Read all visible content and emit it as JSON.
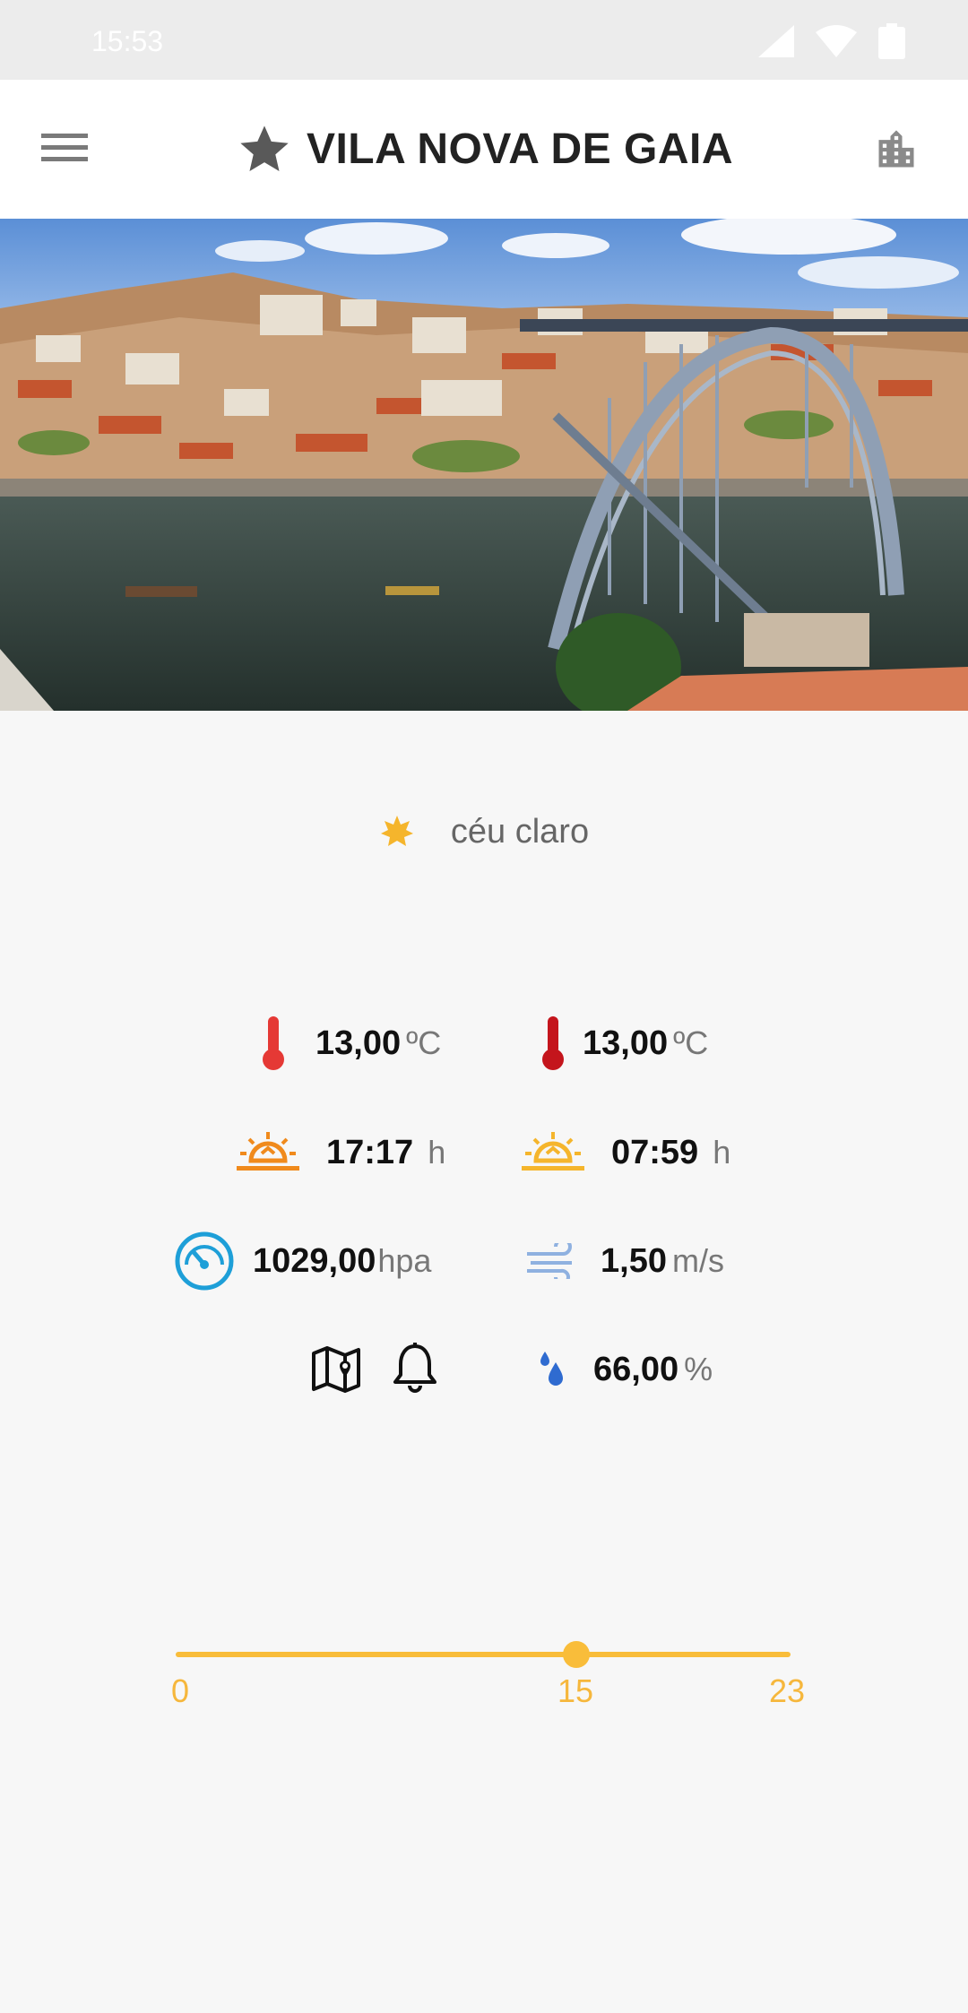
{
  "status_bar": {
    "time": "15:53"
  },
  "app_bar": {
    "title": "VILA NOVA DE GAIA"
  },
  "weather": {
    "condition": "céu claro",
    "temp": {
      "value": "13,00",
      "unit": "ºC"
    },
    "temp_max": {
      "value": "13,00",
      "unit": "ºC"
    },
    "sunset": {
      "value": "17:17",
      "unit": "h"
    },
    "sunrise": {
      "value": "07:59",
      "unit": "h"
    },
    "pressure": {
      "value": "1029,00",
      "unit": "hpa"
    },
    "wind": {
      "value": "1,50",
      "unit": "m/s"
    },
    "humidity": {
      "value": "66,00",
      "unit": "%"
    }
  },
  "hour_slider": {
    "min": "0",
    "current": "15",
    "max": "23",
    "min_value": 0,
    "value": 15,
    "max_value": 23
  },
  "colors": {
    "accent": "#f9bd3a",
    "temp_red": "#e53935",
    "pressure_blue": "#1e9fd8",
    "wind_blue": "#8fb1e0"
  }
}
